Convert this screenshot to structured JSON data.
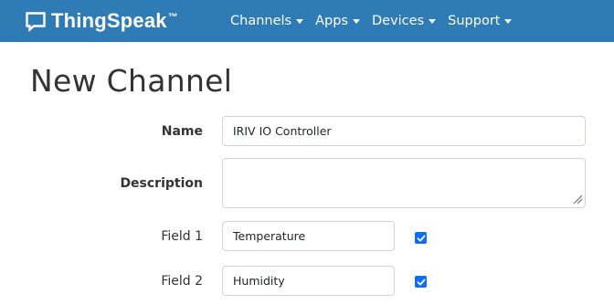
{
  "navbar": {
    "brand": "ThingSpeak",
    "brand_mark": "™",
    "brand_icon": "chat-bubble-icon",
    "menu": [
      {
        "label": "Channels",
        "icon": "caret-down-icon"
      },
      {
        "label": "Apps",
        "icon": "caret-down-icon"
      },
      {
        "label": "Devices",
        "icon": "caret-down-icon"
      },
      {
        "label": "Support",
        "icon": "caret-down-icon"
      }
    ]
  },
  "page": {
    "title": "New Channel"
  },
  "form": {
    "name": {
      "label": "Name",
      "value": "IRIV IO Controller"
    },
    "description": {
      "label": "Description",
      "value": ""
    },
    "fields": [
      {
        "label": "Field 1",
        "value": "Temperature",
        "enabled": true
      },
      {
        "label": "Field 2",
        "value": "Humidity",
        "enabled": true
      }
    ]
  },
  "colors": {
    "navbar": "#2e7bb5",
    "checkbox": "#0d6efd",
    "input_border": "#ced4da"
  }
}
